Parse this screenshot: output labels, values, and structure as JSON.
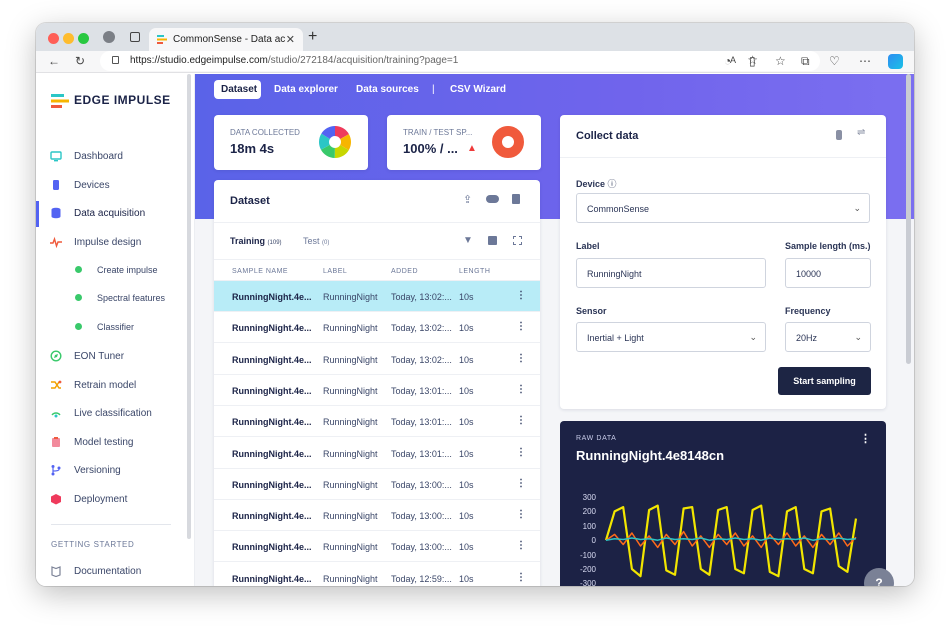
{
  "browser": {
    "tab_title": "CommonSense - Data acquisitio",
    "url_host": "https://studio.edgeimpulse.com",
    "url_path": "/studio/272184/acquisition/training?page=1"
  },
  "sidebar": {
    "brand": "EDGE IMPULSE",
    "items": [
      {
        "label": "Dashboard"
      },
      {
        "label": "Devices"
      },
      {
        "label": "Data acquisition"
      },
      {
        "label": "Impulse design"
      },
      {
        "label": "Create impulse"
      },
      {
        "label": "Spectral features"
      },
      {
        "label": "Classifier"
      },
      {
        "label": "EON Tuner"
      },
      {
        "label": "Retrain model"
      },
      {
        "label": "Live classification"
      },
      {
        "label": "Model testing"
      },
      {
        "label": "Versioning"
      },
      {
        "label": "Deployment"
      }
    ],
    "section_getting_started": "GETTING STARTED",
    "documentation": "Documentation"
  },
  "topnav": {
    "tabs": [
      "Dataset",
      "Data explorer",
      "Data sources",
      "|",
      "CSV Wizard"
    ]
  },
  "stats": {
    "collected_label": "DATA COLLECTED",
    "collected_value": "18m 4s",
    "split_label": "TRAIN / TEST SP...",
    "split_value": "100% / ..."
  },
  "dataset": {
    "title": "Dataset",
    "tab_training": "Training",
    "training_count": "(109)",
    "tab_test": "Test",
    "test_count": "(0)",
    "columns": [
      "SAMPLE NAME",
      "LABEL",
      "ADDED",
      "LENGTH"
    ],
    "rows": [
      {
        "name": "RunningNight.4e...",
        "label": "RunningNight",
        "added": "Today, 13:02:...",
        "length": "10s"
      },
      {
        "name": "RunningNight.4e...",
        "label": "RunningNight",
        "added": "Today, 13:02:...",
        "length": "10s"
      },
      {
        "name": "RunningNight.4e...",
        "label": "RunningNight",
        "added": "Today, 13:02:...",
        "length": "10s"
      },
      {
        "name": "RunningNight.4e...",
        "label": "RunningNight",
        "added": "Today, 13:01:...",
        "length": "10s"
      },
      {
        "name": "RunningNight.4e...",
        "label": "RunningNight",
        "added": "Today, 13:01:...",
        "length": "10s"
      },
      {
        "name": "RunningNight.4e...",
        "label": "RunningNight",
        "added": "Today, 13:01:...",
        "length": "10s"
      },
      {
        "name": "RunningNight.4e...",
        "label": "RunningNight",
        "added": "Today, 13:00:...",
        "length": "10s"
      },
      {
        "name": "RunningNight.4e...",
        "label": "RunningNight",
        "added": "Today, 13:00:...",
        "length": "10s"
      },
      {
        "name": "RunningNight.4e...",
        "label": "RunningNight",
        "added": "Today, 13:00:...",
        "length": "10s"
      },
      {
        "name": "RunningNight.4e...",
        "label": "RunningNight",
        "added": "Today, 12:59:...",
        "length": "10s"
      }
    ],
    "row_menu": "⋮"
  },
  "collect": {
    "title": "Collect data",
    "device_label": "Device",
    "device_value": "CommonSense",
    "label_label": "Label",
    "label_value": "RunningNight",
    "sample_length_label": "Sample length (ms.)",
    "sample_length_value": "10000",
    "sensor_label": "Sensor",
    "sensor_value": "Inertial + Light",
    "frequency_label": "Frequency",
    "frequency_value": "20Hz",
    "start_button": "Start sampling"
  },
  "raw": {
    "label": "RAW DATA",
    "title": "RunningNight.4e8148cn",
    "yticks": [
      "300",
      "200",
      "100",
      "0",
      "-100",
      "-200",
      "-300"
    ],
    "menu": "⋮"
  },
  "help_button": "?",
  "colors": {
    "accent": "#5363f2",
    "hero": "#6a63ea",
    "selected_row": "#b8ecf7",
    "dark_button": "#1d2544",
    "raw_bg": "#1c2245",
    "series_yellow": "#f2e600",
    "series_orange": "#ff6a1a",
    "series_teal": "#2bc6c6"
  },
  "chart_data": {
    "type": "line",
    "title": "RunningNight.4e8148cn",
    "xlabel": "",
    "ylabel": "",
    "ylim": [
      -300,
      300
    ],
    "series": [
      {
        "values": [
          0,
          200,
          230,
          -200,
          -250,
          210,
          240,
          -210,
          -240,
          220,
          230,
          -200,
          -240,
          210,
          230,
          -200,
          -230,
          210,
          240,
          -220,
          -250,
          200,
          230,
          -200,
          -230,
          200,
          220,
          -180,
          -220,
          150
        ]
      },
      {
        "values": [
          0,
          40,
          -30,
          50,
          -40,
          30,
          -50,
          40,
          -30,
          60,
          -40,
          30,
          -50,
          40,
          -30,
          50,
          -40,
          30,
          -50,
          40,
          -30,
          50,
          -40,
          30,
          -50,
          40,
          -30,
          50,
          -40,
          20
        ]
      },
      {
        "values": [
          0,
          10,
          5,
          15,
          5,
          10,
          0,
          15,
          5,
          10,
          5,
          15,
          0,
          10,
          5,
          15,
          5,
          10,
          0,
          15,
          5,
          10,
          5,
          15,
          0,
          10,
          5,
          15,
          5,
          10
        ]
      }
    ]
  }
}
